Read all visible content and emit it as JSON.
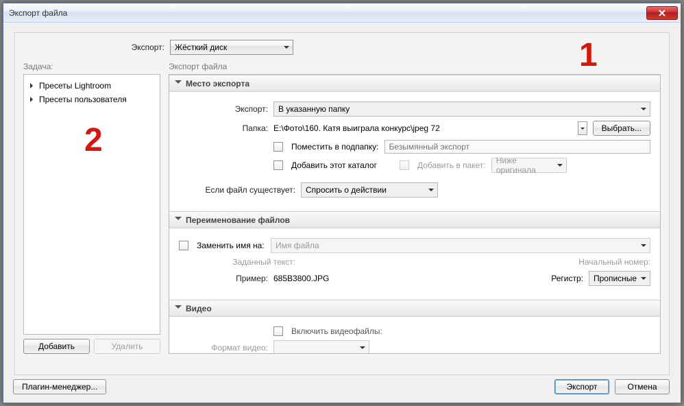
{
  "window": {
    "title": "Экспорт файла"
  },
  "exportTo": {
    "label": "Экспорт:",
    "value": "Жёсткий диск"
  },
  "leftPanel": {
    "header": "Задача:",
    "presets": [
      "Пресеты Lightroom",
      "Пресеты пользователя"
    ],
    "addBtn": "Добавить",
    "removeBtn": "Удалить"
  },
  "rightPanel": {
    "header": "Экспорт файла"
  },
  "sectionLocation": {
    "title": "Место экспорта",
    "exportToLabel": "Экспорт:",
    "exportToValue": "В указанную папку",
    "folderLabel": "Папка:",
    "folderPath": "E:\\Фото\\160. Катя выиграла конкурс\\jpeg 72",
    "chooseBtn": "Выбрать...",
    "subfolderLabel": "Поместить в подпапку:",
    "subfolderPlaceholder": "Безымянный экспорт",
    "addCatalogLabel": "Добавить этот каталог",
    "addStackLabel": "Добавить в пакет:",
    "stackValue": "Ниже оригинала",
    "existingLabel": "Если файл существует:",
    "existingValue": "Спросить о действии"
  },
  "sectionRename": {
    "title": "Переименование файлов",
    "renameLabel": "Заменить имя на:",
    "templateValue": "Имя файла",
    "customTextLabel": "Заданный текст:",
    "startNumberLabel": "Начальный номер:",
    "exampleLabel": "Пример:",
    "exampleValue": "685B3800.JPG",
    "caseLabel": "Регистр:",
    "caseValue": "Прописные"
  },
  "sectionVideo": {
    "title": "Видео",
    "includeLabel": "Включить видеофайлы:",
    "formatLabel": "Формат видео:"
  },
  "footer": {
    "plugin": "Плагин-менеджер...",
    "export": "Экспорт",
    "cancel": "Отмена"
  },
  "annotations": {
    "one": "1",
    "two": "2"
  }
}
